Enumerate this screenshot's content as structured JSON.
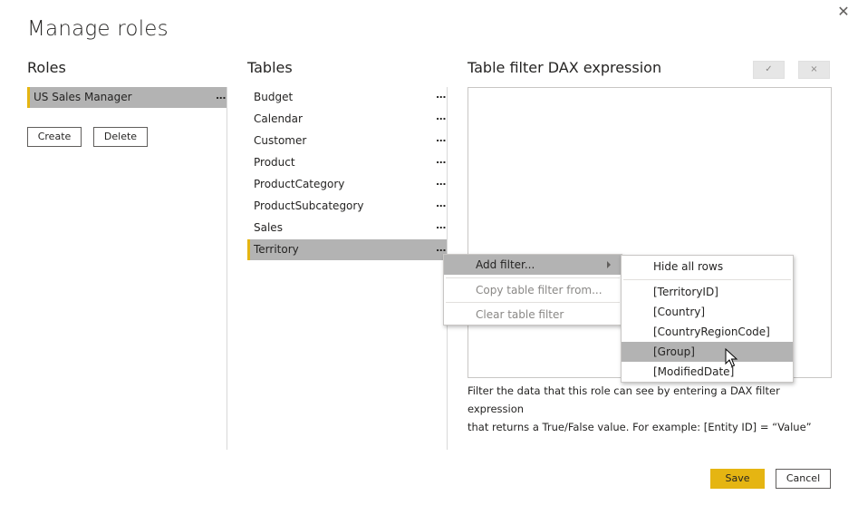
{
  "dialog": {
    "title": "Manage roles",
    "close_icon": "close-icon"
  },
  "roles": {
    "header": "Roles",
    "items": [
      {
        "label": "US Sales Manager",
        "selected": true,
        "more": "..."
      }
    ],
    "create_label": "Create",
    "delete_label": "Delete"
  },
  "tables": {
    "header": "Tables",
    "items": [
      {
        "label": "Budget",
        "more": "..."
      },
      {
        "label": "Calendar",
        "more": "..."
      },
      {
        "label": "Customer",
        "more": "..."
      },
      {
        "label": "Product",
        "more": "..."
      },
      {
        "label": "ProductCategory",
        "more": "..."
      },
      {
        "label": "ProductSubcategory",
        "more": "..."
      },
      {
        "label": "Sales",
        "more": "..."
      },
      {
        "label": "Territory",
        "more": "...",
        "selected": true
      }
    ]
  },
  "dax": {
    "header": "Table filter DAX expression",
    "confirm_icon": "checkmark-icon",
    "confirm_glyph": "✓",
    "cancel_icon": "close-icon",
    "cancel_glyph": "×",
    "expression": "",
    "help_line1": "Filter the data that this role can see by entering a DAX filter expression",
    "help_line2": "that returns a True/False value. For example: [Entity ID] = “Value”"
  },
  "context_menu": {
    "items": [
      {
        "label": "Add filter...",
        "enabled": true,
        "highlighted": true,
        "has_submenu": true
      },
      {
        "label": "Copy table filter from...",
        "enabled": false
      },
      {
        "label": "Clear table filter",
        "enabled": false
      }
    ]
  },
  "submenu": {
    "items": [
      {
        "label": "Hide all rows"
      },
      {
        "label": "[TerritoryID]"
      },
      {
        "label": "[Country]"
      },
      {
        "label": "[CountryRegionCode]"
      },
      {
        "label": "[Group]",
        "highlighted": true
      },
      {
        "label": "[ModifiedDate]"
      }
    ]
  },
  "footer": {
    "save_label": "Save",
    "cancel_label": "Cancel"
  },
  "colors": {
    "accent": "#e5b512",
    "selection": "#b3b3b3",
    "border": "#c8c6c4"
  }
}
